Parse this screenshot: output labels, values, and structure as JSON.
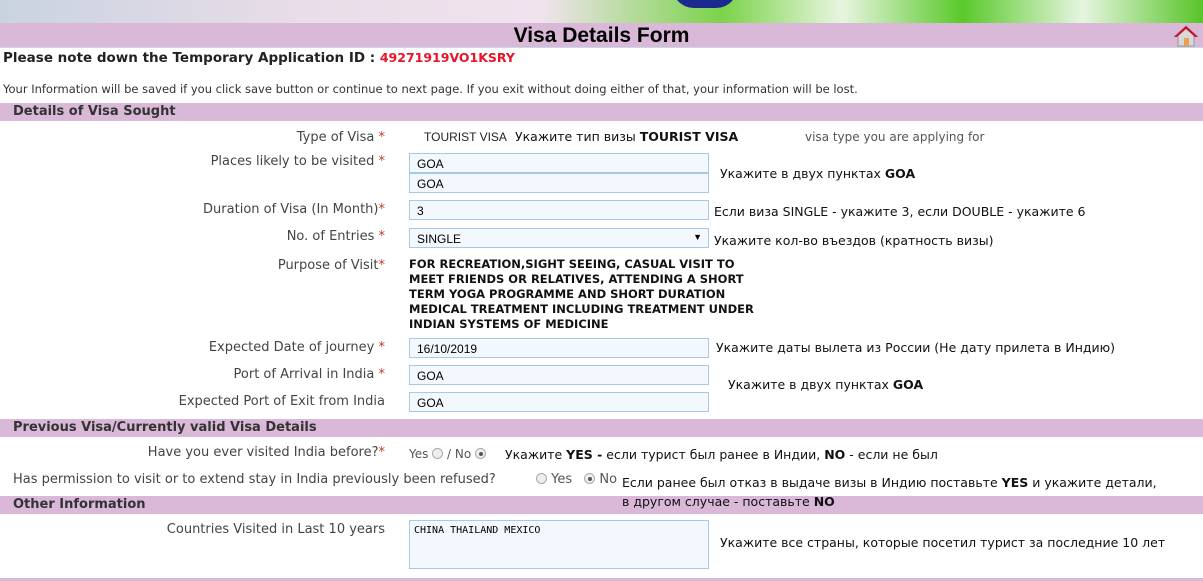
{
  "header": {
    "title": "Visa Details Form",
    "home_icon": "home-icon"
  },
  "app_id": {
    "label": "Please note down the Temporary Application ID :",
    "value": "49271919VO1KSRY",
    "color": "#e8142a"
  },
  "info": "Your Information will be saved if you click save button or continue to next page. If you exit without doing either of that, your information will be lost.",
  "sections": {
    "visa_sought": "Details of Visa Sought",
    "previous_visa": "Previous Visa/Currently valid Visa Details",
    "other": "Other Information"
  },
  "fields": {
    "type_of_visa": {
      "label": "Type of Visa",
      "value": "TOURIST VISA",
      "note_prefix": "Укажите тип визы",
      "note_bold": "TOURIST VISA",
      "hint": "visa type you are applying for"
    },
    "places": {
      "label": "Places likely to be visited",
      "value1": "GOA",
      "value2": "GOA",
      "note_prefix": "Укажите в двух пунктах",
      "note_bold": "GOA"
    },
    "duration": {
      "label": "Duration of Visa (In Month)",
      "value": "3",
      "note": "Если виза SINGLE - укажите 3, если DOUBLE - укажите 6"
    },
    "entries": {
      "label": "No. of Entries",
      "value": "SINGLE",
      "note": "Укажите кол-во въездов (кратность визы)"
    },
    "purpose": {
      "label": "Purpose of Visit",
      "value": "FOR RECREATION,SIGHT SEEING, CASUAL VISIT TO\nMEET FRIENDS OR RELATIVES, ATTENDING A SHORT\nTERM YOGA PROGRAMME AND SHORT DURATION\nMEDICAL TREATMENT INCLUDING TREATMENT UNDER\nINDIAN SYSTEMS OF MEDICINE"
    },
    "journey_date": {
      "label": "Expected Date of journey",
      "value": "16/10/2019",
      "note": "Укажите даты вылета из России (Не дату прилета в Индию)"
    },
    "port_arrival": {
      "label": "Port of Arrival in India",
      "value": "GOA"
    },
    "port_exit": {
      "label": "Expected Port of Exit from India",
      "value": "GOA"
    },
    "ports_note_prefix": "Укажите в двух пунктах",
    "ports_note_bold": "GOA",
    "visited_before": {
      "label": "Have you ever visited India before?",
      "yes": "Yes",
      "sep": "/ No",
      "selected": "No",
      "note_a": "Укажите",
      "note_b": "YES -",
      "note_c": "если турист был ранее в Индии,",
      "note_d": "NO",
      "note_e": "- если не был"
    },
    "refused": {
      "label": "Has permission to visit or to extend stay in India previously been refused?",
      "yes": "Yes",
      "no": "No",
      "selected": "No",
      "note1_a": "Если ранее был отказ в выдаче визы в Индию поставьте",
      "note1_b": "YES",
      "note1_c": "и укажите детали,",
      "note2_a": "в другом случае - поставьте",
      "note2_b": "NO"
    },
    "countries": {
      "label": "Countries Visited in Last 10 years",
      "value": "CHINA THAILAND MEXICO",
      "note": "Укажите все страны, которые посетил турист за последние 10 лет"
    }
  },
  "required_mark": "*"
}
